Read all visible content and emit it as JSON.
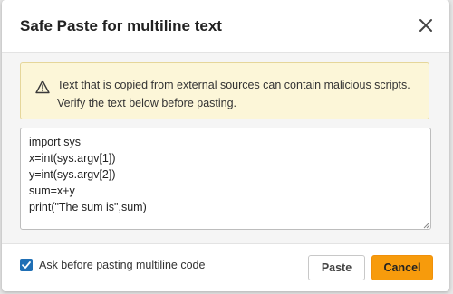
{
  "dialog": {
    "title": "Safe Paste for multiline text",
    "close_icon": "close-icon"
  },
  "warning": {
    "icon": "warning-triangle-icon",
    "text": "Text that is copied from external sources can contain malicious scripts. Verify the text below before pasting."
  },
  "code": {
    "value": "import sys\nx=int(sys.argv[1])\ny=int(sys.argv[2])\nsum=x+y\nprint(\"The sum is\",sum)"
  },
  "footer": {
    "checkbox_label": "Ask before pasting multiline code",
    "checkbox_checked": true,
    "paste_label": "Paste",
    "cancel_label": "Cancel"
  },
  "colors": {
    "accent": "#f79b0c",
    "checkbox": "#1f6fb5",
    "warning_bg": "#fcf6d8"
  }
}
